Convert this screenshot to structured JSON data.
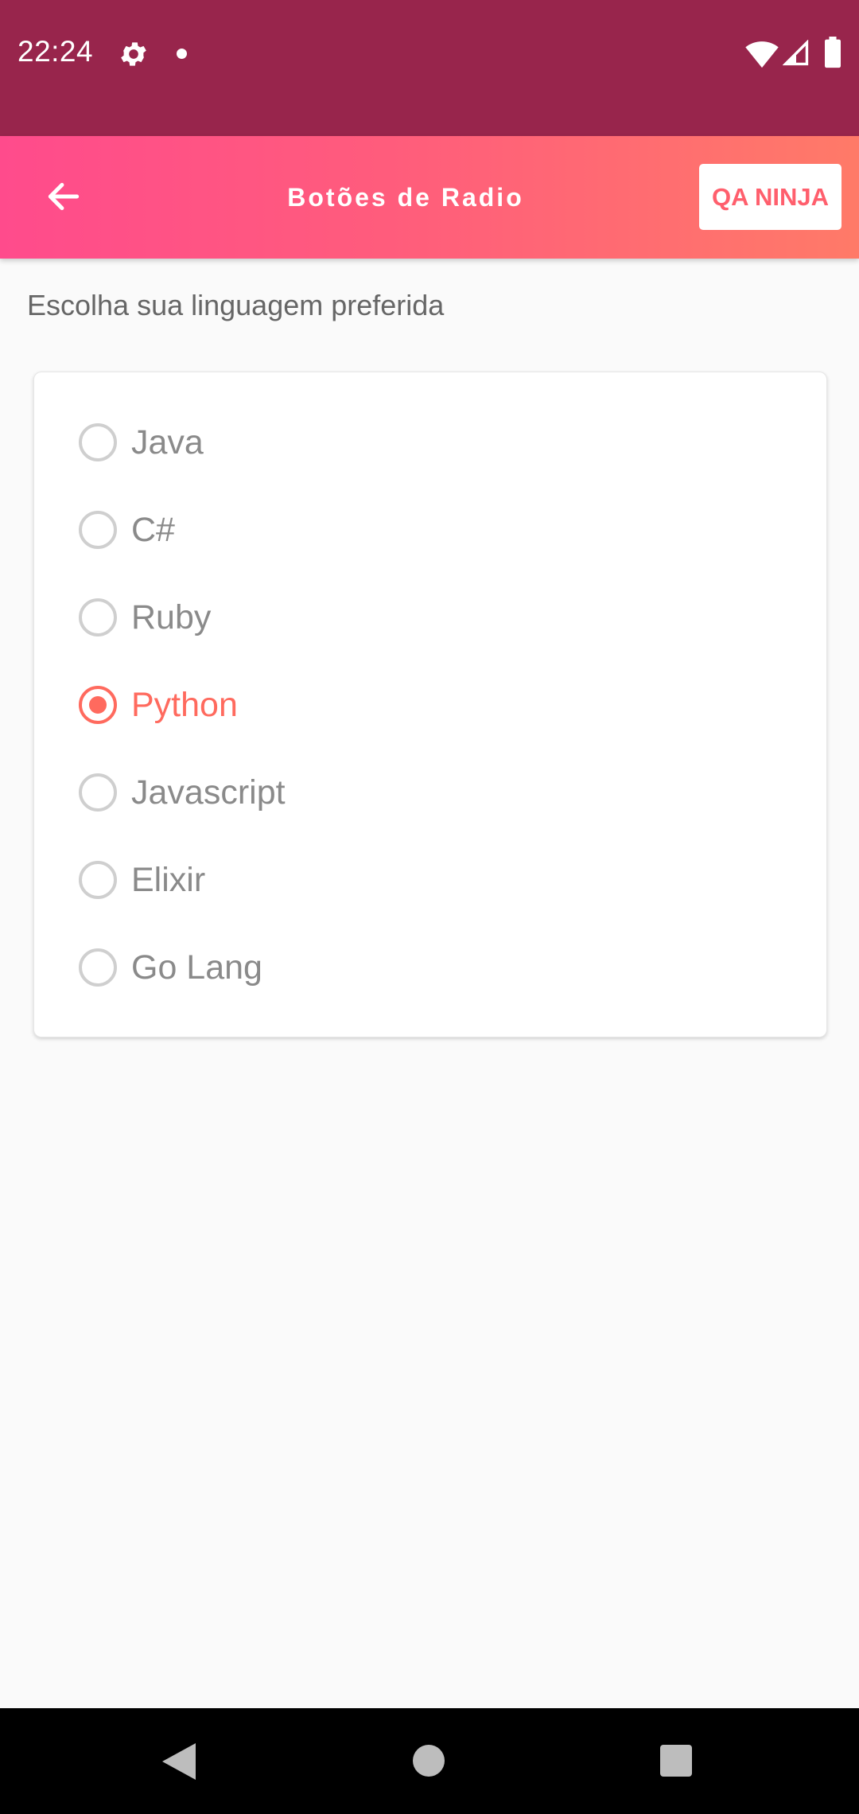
{
  "status_bar": {
    "time": "22:24",
    "icons": [
      "gear-icon",
      "notification-dot-icon",
      "wifi-icon",
      "cellular-signal-icon",
      "battery-icon"
    ],
    "background": "#98254c"
  },
  "app_bar": {
    "title": "Botões de Radio",
    "back_icon": "arrow-back-icon",
    "action_label": "QA NINJA",
    "gradient_start": "#ff4b8c",
    "gradient_end": "#ff7a68"
  },
  "content": {
    "prompt": "Escolha sua linguagem preferida",
    "accent_color": "#ff6a5e",
    "options": [
      {
        "label": "Java",
        "checked": false
      },
      {
        "label": "C#",
        "checked": false
      },
      {
        "label": "Ruby",
        "checked": false
      },
      {
        "label": "Python",
        "checked": true
      },
      {
        "label": "Javascript",
        "checked": false
      },
      {
        "label": "Elixir",
        "checked": false
      },
      {
        "label": "Go Lang",
        "checked": false
      }
    ]
  },
  "nav_bar": {
    "icons": [
      "nav-back-icon",
      "nav-home-icon",
      "nav-recents-icon"
    ]
  }
}
